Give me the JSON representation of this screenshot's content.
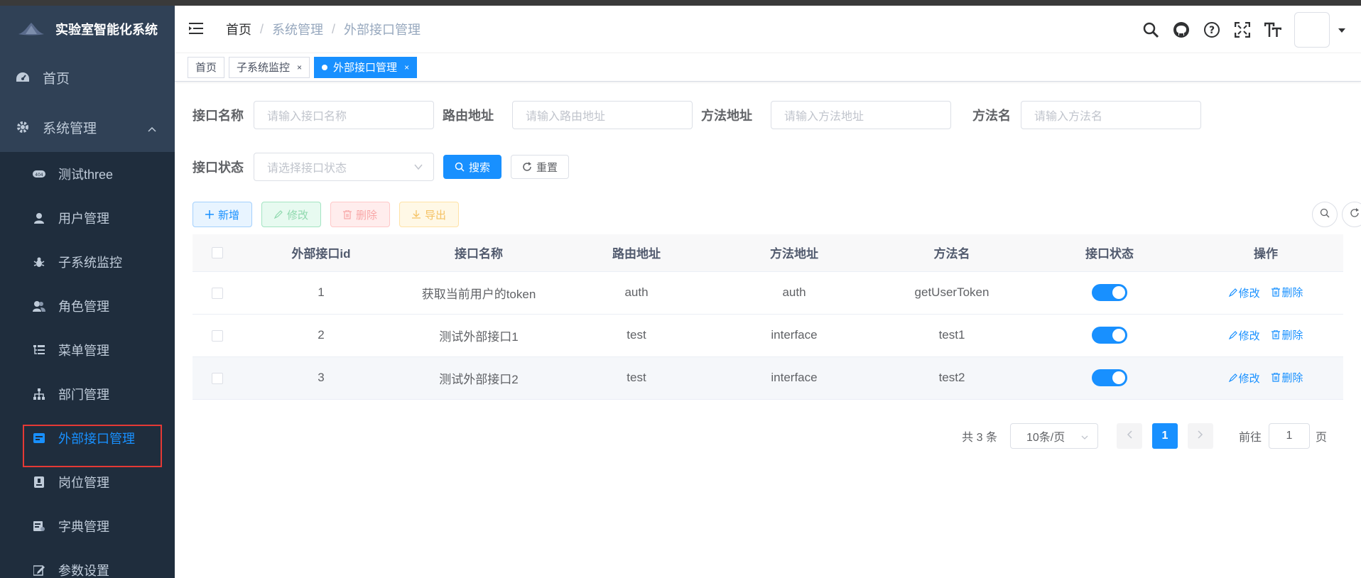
{
  "app": {
    "title": "实验室智能化系统"
  },
  "sidebar": {
    "items": [
      {
        "label": "首页",
        "icon": "dashboard-icon"
      },
      {
        "label": "系统管理",
        "icon": "gear-icon",
        "expanded": true
      }
    ],
    "subitems": [
      {
        "label": "测试three",
        "icon": "404-icon"
      },
      {
        "label": "用户管理",
        "icon": "user-icon"
      },
      {
        "label": "子系统监控",
        "icon": "bug-icon"
      },
      {
        "label": "角色管理",
        "icon": "peoples-icon"
      },
      {
        "label": "菜单管理",
        "icon": "tree-table-icon"
      },
      {
        "label": "部门管理",
        "icon": "tree-icon"
      },
      {
        "label": "外部接口管理",
        "icon": "interface-icon",
        "active": true
      },
      {
        "label": "岗位管理",
        "icon": "post-icon"
      },
      {
        "label": "字典管理",
        "icon": "dict-icon"
      },
      {
        "label": "参数设置",
        "icon": "edit-icon"
      }
    ]
  },
  "breadcrumb": [
    "首页",
    "系统管理",
    "外部接口管理"
  ],
  "tags": [
    {
      "label": "首页"
    },
    {
      "label": "子系统监控",
      "close": "×"
    },
    {
      "label": "外部接口管理",
      "close": "×",
      "active": true
    }
  ],
  "search": {
    "fields": [
      {
        "label": "接口名称",
        "placeholder": "请输入接口名称"
      },
      {
        "label": "路由地址",
        "placeholder": "请输入路由地址"
      },
      {
        "label": "方法地址",
        "placeholder": "请输入方法地址"
      },
      {
        "label": "方法名",
        "placeholder": "请输入方法名"
      }
    ],
    "status_label": "接口状态",
    "status_placeholder": "请选择接口状态",
    "search_button": "搜索",
    "reset_button": "重置"
  },
  "toolbar": {
    "add": "新增",
    "edit": "修改",
    "delete": "删除",
    "export": "导出"
  },
  "table": {
    "columns": [
      "外部接口id",
      "接口名称",
      "路由地址",
      "方法地址",
      "方法名",
      "接口状态",
      "操作"
    ],
    "rows": [
      {
        "id": "1",
        "name": "获取当前用户的token",
        "route": "auth",
        "method_path": "auth",
        "method_name": "getUserToken",
        "enabled": true
      },
      {
        "id": "2",
        "name": "测试外部接口1",
        "route": "test",
        "method_path": "interface",
        "method_name": "test1",
        "enabled": true
      },
      {
        "id": "3",
        "name": "测试外部接口2",
        "route": "test",
        "method_path": "interface",
        "method_name": "test2",
        "enabled": true
      }
    ],
    "op_edit": "修改",
    "op_delete": "删除"
  },
  "pagination": {
    "total_text": "共 3 条",
    "page_size": "10条/页",
    "current_page": "1",
    "goto_label": "前往",
    "goto_value": "1",
    "page_suffix": "页"
  },
  "colors": {
    "sidebar_bg": "#304156",
    "accent": "#1890ff",
    "highlight_box": "#e53935"
  }
}
